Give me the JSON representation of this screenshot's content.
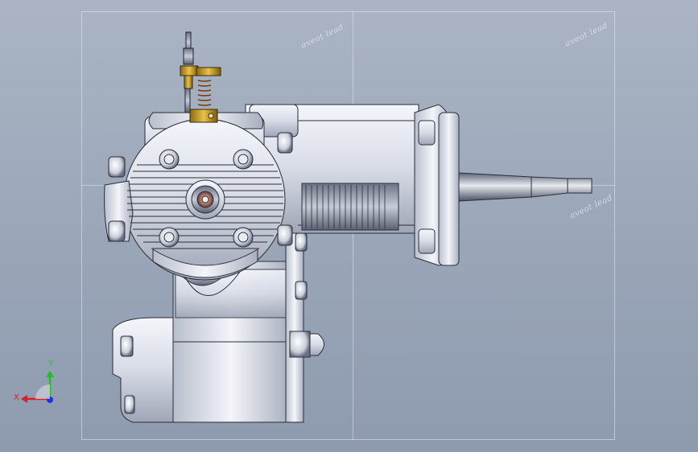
{
  "viewport": {
    "background_top": "#aab4c4",
    "background_bottom": "#8e9aae"
  },
  "watermarks": [
    "aveot lead",
    "aveot lead",
    "aveot lead"
  ],
  "triad": {
    "x_label": "X",
    "y_label": "Y",
    "x_color": "#e02020",
    "y_color": "#20c020",
    "z_color": "#2030e0"
  },
  "model": {
    "name_icon": "engine-model-icon"
  }
}
